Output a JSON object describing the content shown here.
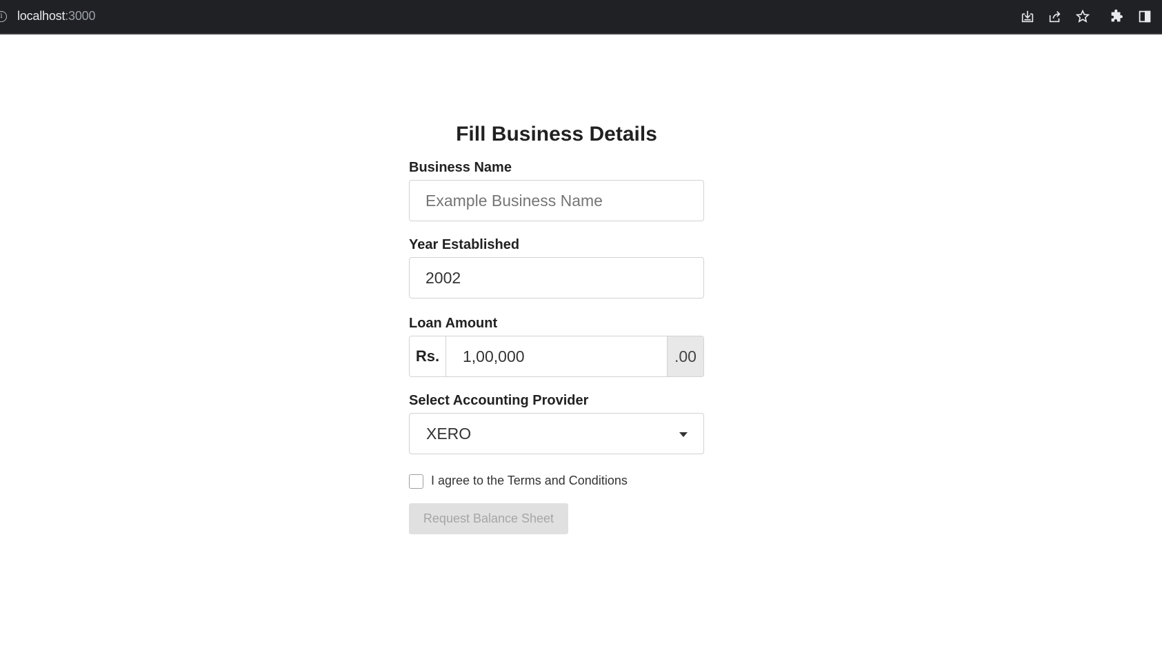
{
  "browser": {
    "host": "localhost",
    "port": ":3000",
    "icons": [
      "info-icon",
      "install-icon",
      "share-icon",
      "star-icon",
      "extensions-icon",
      "side-panel-icon"
    ]
  },
  "form": {
    "title": "Fill Business Details",
    "business_name": {
      "label": "Business Name",
      "placeholder": "Example Business Name",
      "value": ""
    },
    "year_established": {
      "label": "Year Established",
      "value": "2002"
    },
    "loan_amount": {
      "label": "Loan Amount",
      "prefix": "Rs.",
      "value": "1,00,000",
      "suffix": ".00"
    },
    "accounting_provider": {
      "label": "Select Accounting Provider",
      "selected": "XERO"
    },
    "terms": {
      "label": "I agree to the Terms and Conditions",
      "checked": false
    },
    "submit_label": "Request Balance Sheet"
  }
}
